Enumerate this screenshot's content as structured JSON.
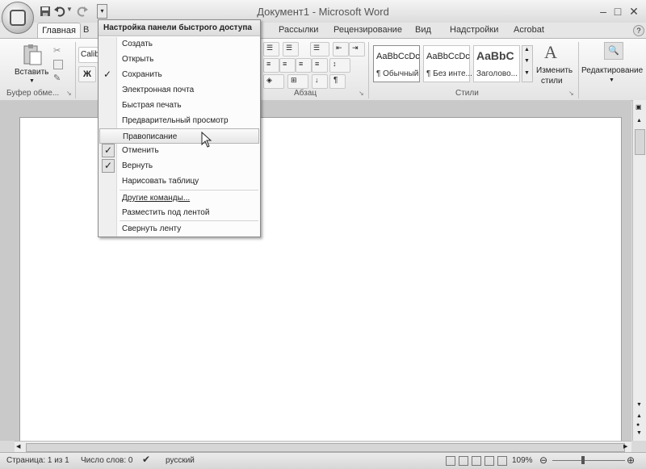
{
  "window": {
    "title": "Документ1 - Microsoft Word"
  },
  "tabs": [
    "Главная",
    "В",
    "Рассылки",
    "Рецензирование",
    "Вид",
    "Надстройки",
    "Acrobat"
  ],
  "ribbon": {
    "paste_label": "Вставить",
    "clipboard_group": "Буфер обме...",
    "font_name": "Calib",
    "bold_label": "Ж",
    "paragraph_group": "Абзац",
    "styles_group": "Стили",
    "styles": [
      {
        "sample": "AaBbCcDc",
        "name": "¶ Обычный"
      },
      {
        "sample": "AaBbCcDc",
        "name": "¶ Без инте..."
      },
      {
        "sample": "AaBbC",
        "name": "Заголово..."
      }
    ],
    "change_styles_line1": "Изменить",
    "change_styles_line2": "стили",
    "editing_label": "Редактирование"
  },
  "qat_menu": {
    "header": "Настройка панели быстрого доступа",
    "items": [
      {
        "label": "Создать",
        "checked": ""
      },
      {
        "label": "Открыть",
        "checked": ""
      },
      {
        "label": "Сохранить",
        "checked": "✓"
      },
      {
        "label": "Электронная почта",
        "checked": ""
      },
      {
        "label": "Быстрая печать",
        "checked": ""
      },
      {
        "label": "Предварительный просмотр",
        "checked": ""
      },
      {
        "label": "Правописание",
        "checked": ""
      },
      {
        "label": "Отменить",
        "checked": "✓"
      },
      {
        "label": "Вернуть",
        "checked": "✓"
      },
      {
        "label": "Нарисовать таблицу",
        "checked": ""
      },
      {
        "label": "Другие команды...",
        "checked": ""
      },
      {
        "label": "Разместить под лентой",
        "checked": ""
      },
      {
        "label": "Свернуть ленту",
        "checked": ""
      }
    ]
  },
  "status": {
    "page": "Страница: 1 из 1",
    "words": "Число слов: 0",
    "language": "русский",
    "zoom": "109%"
  }
}
